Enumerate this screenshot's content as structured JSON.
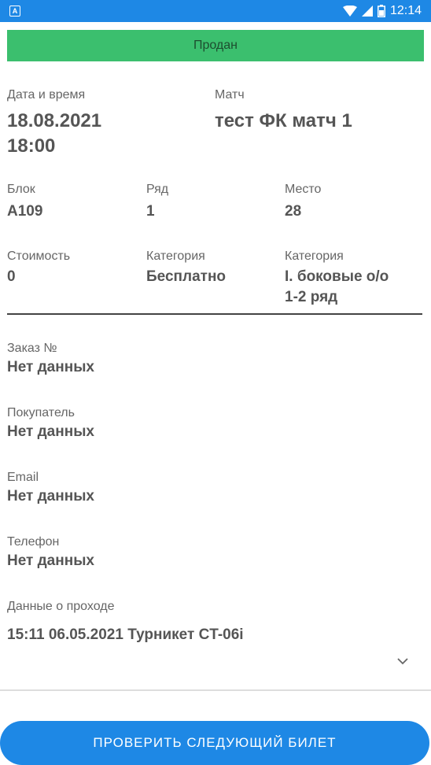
{
  "status_bar": {
    "app_badge": "A",
    "time": "12:14"
  },
  "banner": {
    "status": "Продан"
  },
  "ticket": {
    "datetime_label": "Дата и время",
    "datetime_line1": "18.08.2021",
    "datetime_line2": "18:00",
    "match_label": "Матч",
    "match_value": "тест ФК матч 1",
    "block_label": "Блок",
    "block_value": "A109",
    "row_label": "Ряд",
    "row_value": "1",
    "seat_label": "Место",
    "seat_value": "28",
    "price_label": "Стоимость",
    "price_value": "0",
    "category1_label": "Категория",
    "category1_value": "Бесплатно",
    "category2_label": "Категория",
    "category2_line1": "I. боковые о/о",
    "category2_line2": "1-2 ряд"
  },
  "order": {
    "order_label": "Заказ №",
    "order_value": "Нет данных",
    "buyer_label": "Покупатель",
    "buyer_value": "Нет данных",
    "email_label": "Email",
    "email_value": "Нет данных",
    "phone_label": "Телефон",
    "phone_value": "Нет данных",
    "passage_label": "Данные о проходе",
    "passage_value": "15:11 06.05.2021 Турникет CT-06i"
  },
  "actions": {
    "check_next_label": "ПРОВЕРИТЬ СЛЕДУЮЩИЙ БИЛЕТ"
  },
  "colors": {
    "status_bar": "#1e88e5",
    "banner_green": "#3bbf6e",
    "button_blue": "#1e88e5"
  }
}
